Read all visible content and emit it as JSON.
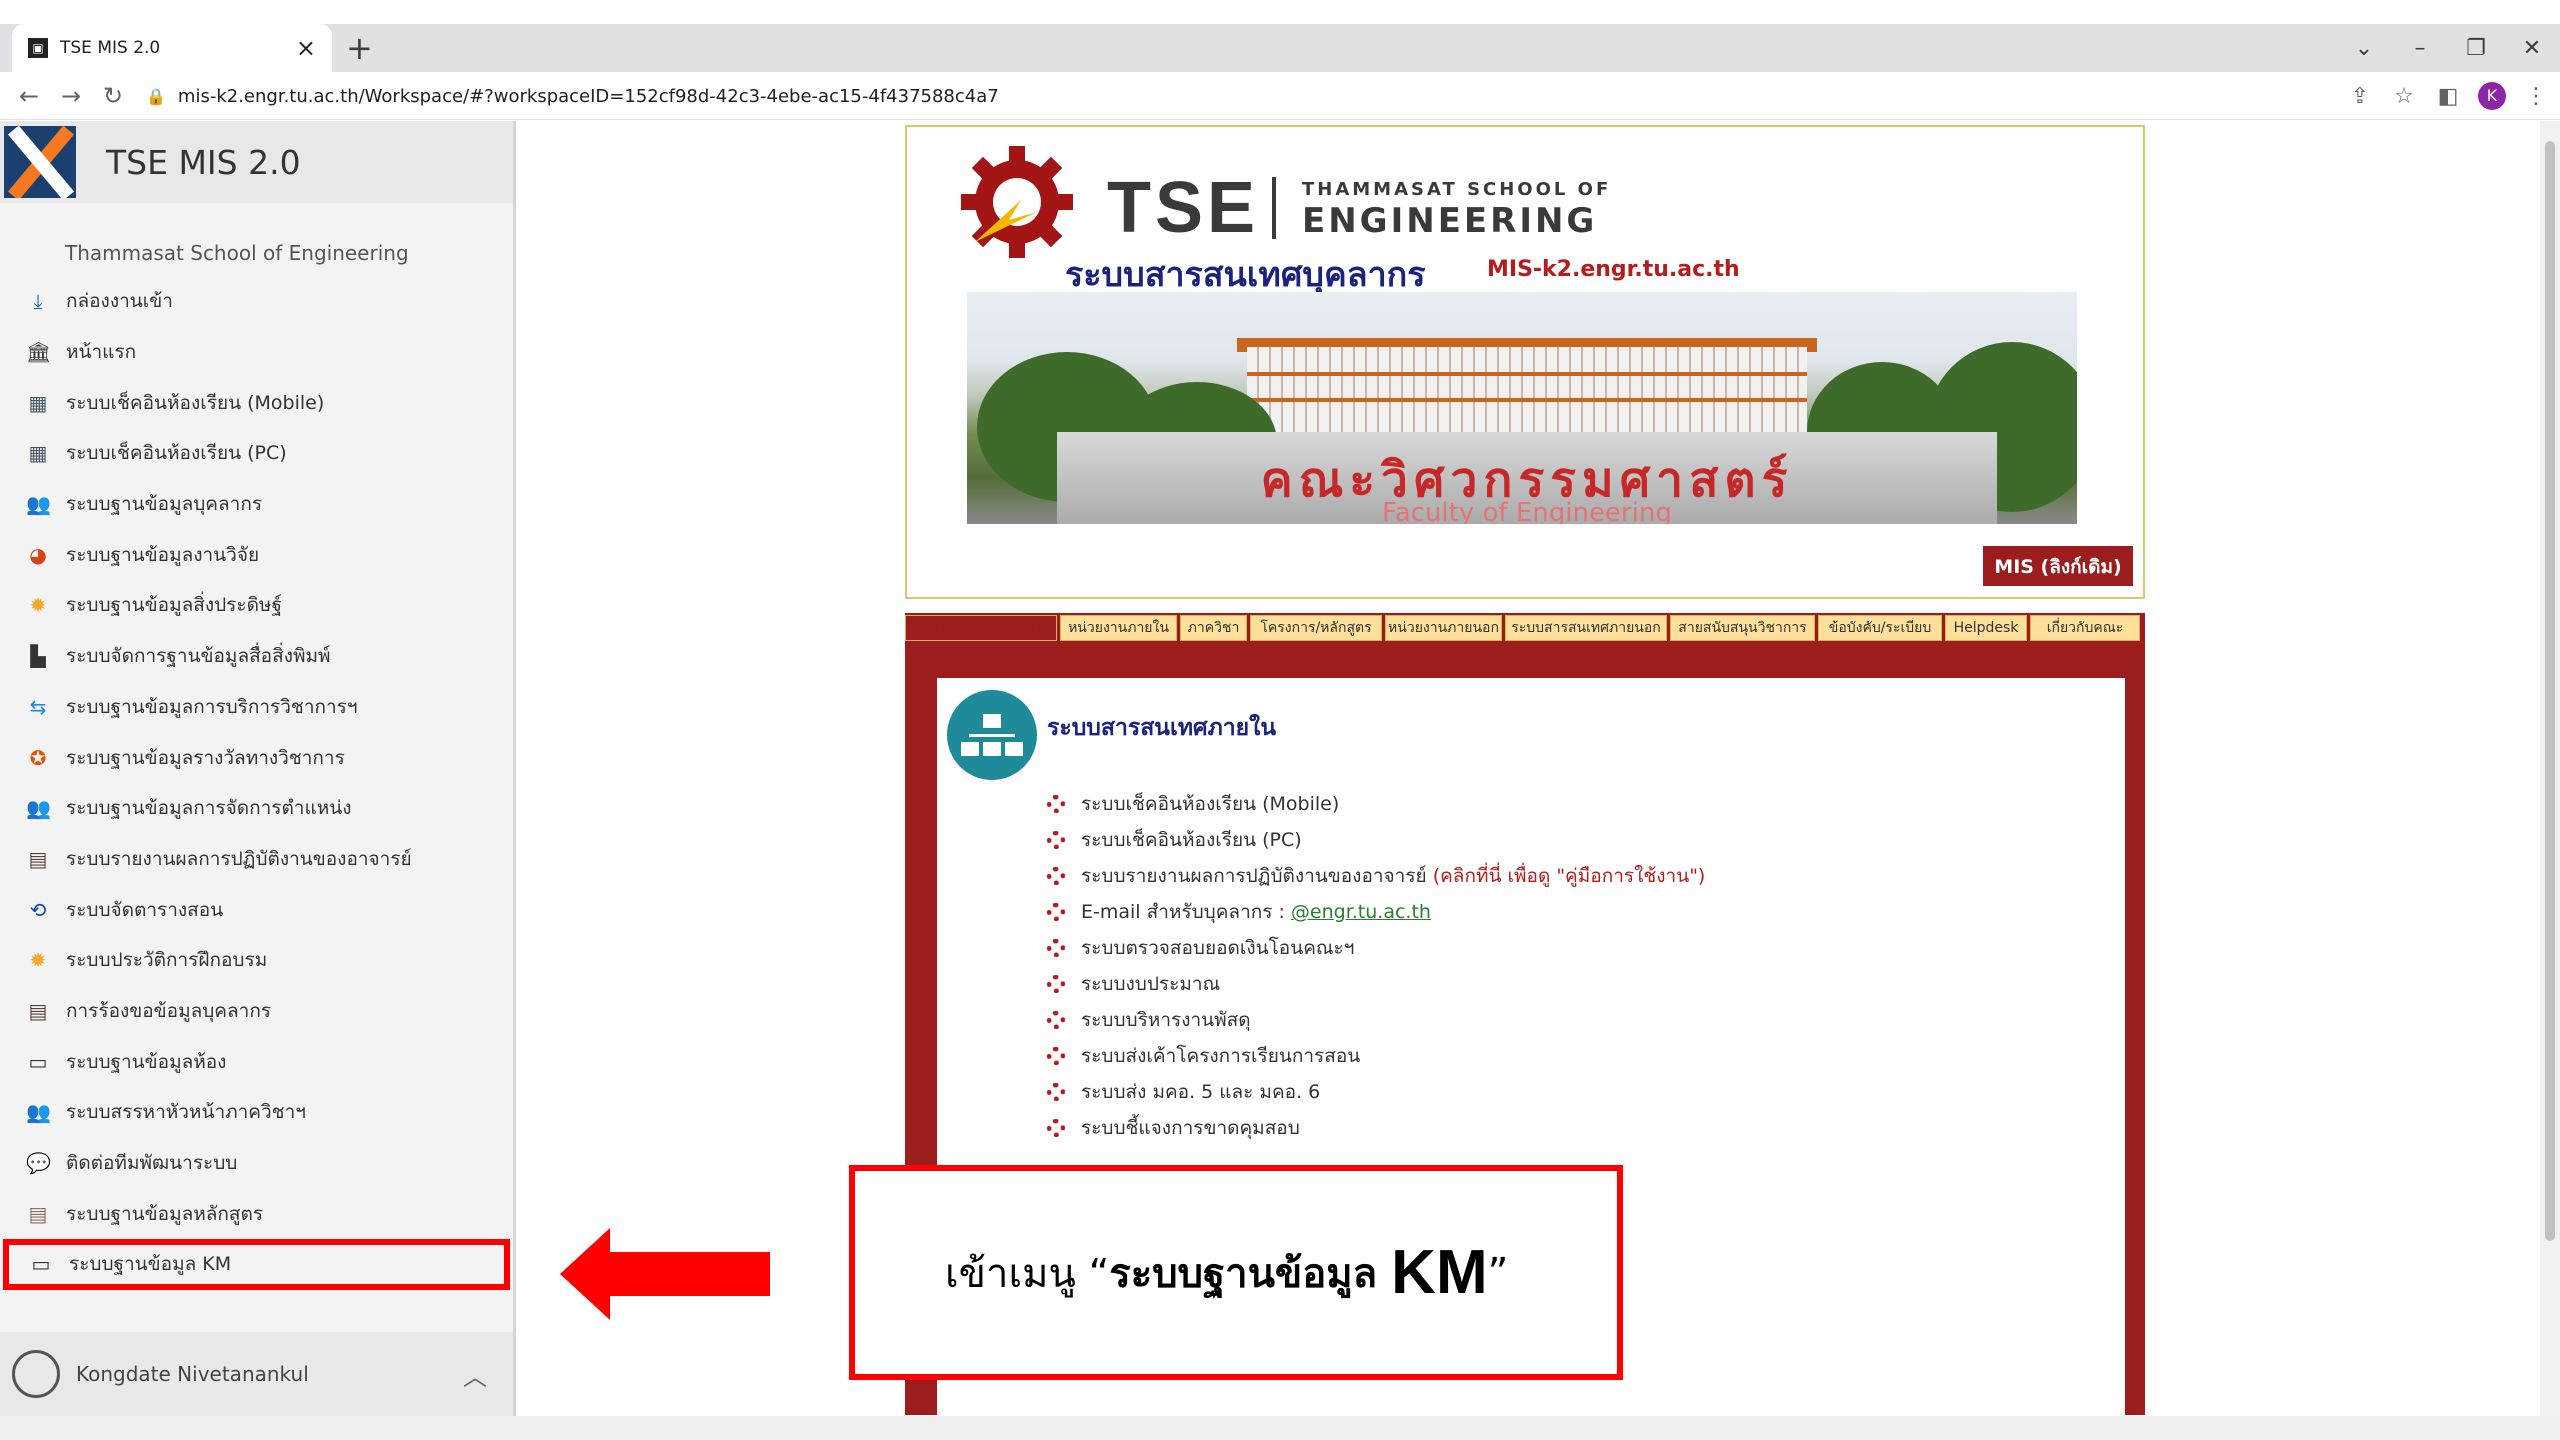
{
  "browser": {
    "tab_title": "TSE MIS 2.0",
    "tab_close": "×",
    "new_tab": "+",
    "url": "mis-k2.engr.tu.ac.th/Workspace/#?workspaceID=152cf98d-42c3-4ebe-ac15-4f437588c4a7",
    "profile_initial": "K"
  },
  "sidebar": {
    "app_title": "TSE MIS 2.0",
    "org_name": "Thammasat School of Engineering",
    "items": [
      {
        "label": "กล่องงานเข้า",
        "icon": "inbox-icon",
        "glyph": "⤓",
        "color": "#1565c0"
      },
      {
        "label": "หน้าแรก",
        "icon": "bank-icon",
        "glyph": "🏛",
        "color": "#333333"
      },
      {
        "label": "ระบบเช็คอินห้องเรียน (Mobile)",
        "icon": "calendar-icon",
        "glyph": "▦",
        "color": "#455a64"
      },
      {
        "label": "ระบบเช็คอินห้องเรียน (PC)",
        "icon": "calendar-icon",
        "glyph": "▦",
        "color": "#455a64"
      },
      {
        "label": "ระบบฐานข้อมูลบุคลากร",
        "icon": "people-icon",
        "glyph": "👥",
        "color": "#333333"
      },
      {
        "label": "ระบบฐานข้อมูลงานวิจัย",
        "icon": "pie-chart-icon",
        "glyph": "◕",
        "color": "#d84315"
      },
      {
        "label": "ระบบฐานข้อมูลสิ่งประดิษฐ์",
        "icon": "sun-icon",
        "glyph": "✹",
        "color": "#f9a825"
      },
      {
        "label": "ระบบจัดการฐานข้อมูลสื่อสิ่งพิมพ์",
        "icon": "factory-icon",
        "glyph": "▙",
        "color": "#333333"
      },
      {
        "label": "ระบบฐานข้อมูลการบริการวิชาการฯ",
        "icon": "handshake-icon",
        "glyph": "⇆",
        "color": "#1e88e5"
      },
      {
        "label": "ระบบฐานข้อมูลรางวัลทางวิชาการ",
        "icon": "award-icon",
        "glyph": "✪",
        "color": "#e65100"
      },
      {
        "label": "ระบบฐานข้อมูลการจัดการตำแหน่ง",
        "icon": "people-icon",
        "glyph": "👥",
        "color": "#333333"
      },
      {
        "label": "ระบบรายงานผลการปฏิบัติงานของอาจารย์",
        "icon": "report-icon",
        "glyph": "▤",
        "color": "#5d4037"
      },
      {
        "label": "ระบบจัดตารางสอน",
        "icon": "history-icon",
        "glyph": "⟲",
        "color": "#0d47a1"
      },
      {
        "label": "ระบบประวัติการฝึกอบรม",
        "icon": "sun-icon",
        "glyph": "✹",
        "color": "#f9a825"
      },
      {
        "label": "การร้องขอข้อมูลบุคลากร",
        "icon": "report-icon",
        "glyph": "▤",
        "color": "#5d4037"
      },
      {
        "label": "ระบบฐานข้อมูลห้อง",
        "icon": "document-icon",
        "glyph": "▭",
        "color": "#333333"
      },
      {
        "label": "ระบบสรรหาหัวหน้าภาควิชาฯ",
        "icon": "people-icon",
        "glyph": "👥",
        "color": "#333333"
      },
      {
        "label": "ติดต่อทีมพัฒนาระบบ",
        "icon": "chat-icon",
        "glyph": "💬",
        "color": "#0288d1"
      },
      {
        "label": "ระบบฐานข้อมูลหลักสูตร",
        "icon": "clipboard-icon",
        "glyph": "▤",
        "color": "#8d6e63"
      },
      {
        "label": "ระบบฐานข้อมูล KM",
        "icon": "document-icon",
        "glyph": "▭",
        "color": "#333333"
      }
    ],
    "user_name": "Kongdate Nivetanankul"
  },
  "banner": {
    "tse": "TSE",
    "school_line1": "THAMMASAT SCHOOL OF",
    "school_line2": "ENGINEERING",
    "thai_title": "ระบบสารสนเทศบุคลากร",
    "site": "MIS-k2.engr.tu.ac.th",
    "faculty_thai": "คณะวิศวกรรมศาสตร์",
    "faculty_en": "Faculty of Engineering",
    "mis_button": "MIS (ลิงก์เดิม)"
  },
  "nav_tabs": [
    "ระบบสารสนเทศภายใน",
    "หน่วยงานภายใน",
    "ภาควิชา",
    "โครงการ/หลักสูตร",
    "หน่วยงานภายนอก",
    "ระบบสารสนเทศภายนอก",
    "สายสนับสนุนวิชาการ",
    "ข้อบังคับ/ระเบียบ",
    "Helpdesk",
    "เกี่ยวกับคณะ"
  ],
  "content": {
    "section_title": "ระบบสารสนเทศภายใน",
    "links": [
      {
        "text": "ระบบเช็คอินห้องเรียน (Mobile)"
      },
      {
        "text": "ระบบเช็คอินห้องเรียน (PC)"
      },
      {
        "text": "ระบบรายงานผลการปฏิบัติงานของอาจารย์",
        "note": "(คลิกที่นี่ เพื่อดู \"คู่มือการใช้งาน\")"
      },
      {
        "text": "E-mail สำหรับบุคลากร :",
        "mail": "@engr.tu.ac.th"
      },
      {
        "text": "ระบบตรวจสอบยอดเงินโอนคณะฯ"
      },
      {
        "text": "ระบบงบประมาณ"
      },
      {
        "text": "ระบบบริหารงานพัสดุ"
      },
      {
        "text": "ระบบส่งเค้าโครงการเรียนการสอน"
      },
      {
        "text": "ระบบส่ง มคอ. 5 และ มคอ. 6"
      },
      {
        "text": "ระบบชี้แจงการขาดคุมสอบ"
      }
    ]
  },
  "callout": {
    "prefix": "เข้าเมนู “",
    "strong": "ระบบฐานข้อมูล",
    "km": "KM",
    "suffix": "”"
  }
}
